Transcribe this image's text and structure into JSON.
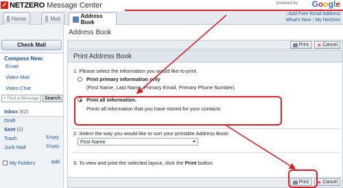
{
  "brand": {
    "name": "NETZERO",
    "product": "Message Center",
    "powered_by": "powered by",
    "google": [
      "G",
      "o",
      "o",
      "g",
      "l",
      "e"
    ]
  },
  "tabs": [
    {
      "label": "Home"
    },
    {
      "label": "Mail"
    },
    {
      "label": "Address Book"
    }
  ],
  "toplinks": {
    "line1": "Add Free Email Address",
    "line2a": "What's New",
    "sep": "|",
    "line2b": "My NetZero",
    "sep2": "|"
  },
  "sidebar": {
    "check_mail": "Check Mail",
    "compose_title": "Compose New:",
    "compose_items": [
      "Email",
      "Video Mail",
      "Video Chat"
    ],
    "search_placeholder": "Find a Message",
    "search_button": "Search",
    "folders": [
      {
        "label": "Inbox",
        "count": "(62)"
      },
      {
        "label": "Draft"
      },
      {
        "label": "Sent",
        "count": "(2)"
      },
      {
        "label": "Trash",
        "action": "Empty"
      },
      {
        "label": "Junk Mail",
        "action": "Empty"
      }
    ],
    "my_folders": "My Folders",
    "add": "Add"
  },
  "main": {
    "page_title": "Address Book",
    "toolbar": {
      "print": "Print",
      "cancel": "Cancel"
    },
    "panel_title": "Print Address Book",
    "step1": "1. Please select the information you would like to print.",
    "option1_title": "Print primary information only",
    "option1_desc": "(First Name, Last Name, Primary Email, Primary Phone Number).",
    "option2_title": "Print all information.",
    "option2_desc": "Prints all information that you have stored for your contacts",
    "step2": "2. Select the way you would like to sort your printable Address Book:",
    "sort_value": "First Name",
    "step3_a": "3. To view and print the selected layout, click the ",
    "step3_b": "Print",
    "step3_c": " button.",
    "bottom": {
      "print": "Print",
      "cancel": "Cancel"
    }
  },
  "colors": {
    "highlight": "#d61f26",
    "link": "#1c4f8a",
    "brand_red": "#d9241c"
  }
}
